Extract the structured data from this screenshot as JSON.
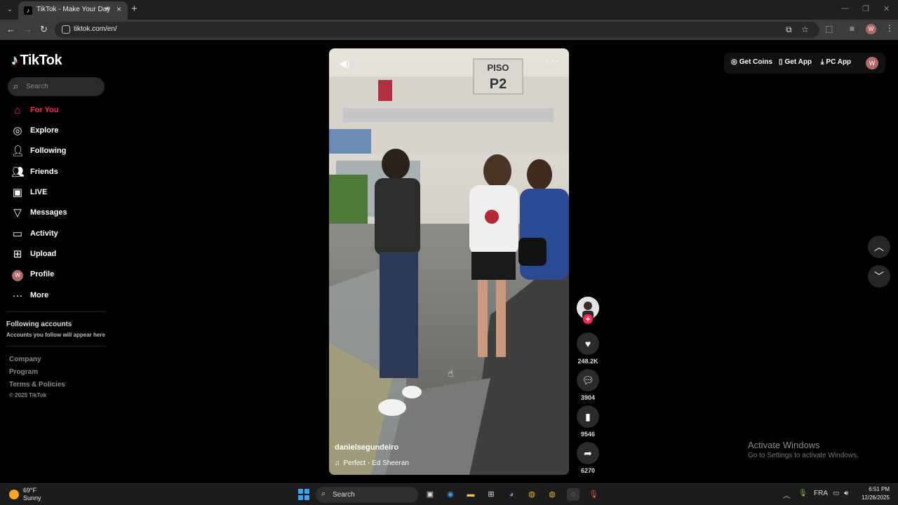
{
  "browser": {
    "tab_title": "TikTok - Make Your Day",
    "url": "tiktok.com/en/",
    "profile_initial": "W"
  },
  "sidebar": {
    "logo": "TikTok",
    "search_placeholder": "Search",
    "items": [
      {
        "label": "For You",
        "icon": "home-icon",
        "active": true
      },
      {
        "label": "Explore",
        "icon": "compass-icon"
      },
      {
        "label": "Following",
        "icon": "user-check-icon"
      },
      {
        "label": "Friends",
        "icon": "users-icon"
      },
      {
        "label": "LIVE",
        "icon": "live-icon"
      },
      {
        "label": "Messages",
        "icon": "send-icon"
      },
      {
        "label": "Activity",
        "icon": "chat-icon"
      },
      {
        "label": "Upload",
        "icon": "plus-square-icon"
      },
      {
        "label": "Profile",
        "icon": "avatar",
        "initial": "W"
      },
      {
        "label": "More",
        "icon": "ellipsis-icon"
      }
    ],
    "following_title": "Following accounts",
    "following_sub": "Accounts you follow will appear here",
    "footer": {
      "company": "Company",
      "program": "Program",
      "terms": "Terms & Policies",
      "copyright": "© 2025 TikTok"
    }
  },
  "video": {
    "author": "danielsegundeiro",
    "music": "Perfect - Ed Sheeran",
    "sign_top": "PISO",
    "sign_bottom": "P2"
  },
  "actions": {
    "likes": "248.2K",
    "comments": "3904",
    "saves": "9546",
    "shares": "6270"
  },
  "top_actions": {
    "get_coins": "Get Coins",
    "get_app": "Get App",
    "pc_app": "PC App",
    "avatar_initial": "W"
  },
  "watermark": {
    "title": "Activate Windows",
    "subtitle": "Go to Settings to activate Windows."
  },
  "taskbar": {
    "temperature": "69°F",
    "condition": "Sunny",
    "search_label": "Search",
    "language": "FRA",
    "time": "6:51 PM",
    "date": "12/26/2025"
  },
  "colors": {
    "accent": "#fe2c55",
    "background": "#000000"
  }
}
